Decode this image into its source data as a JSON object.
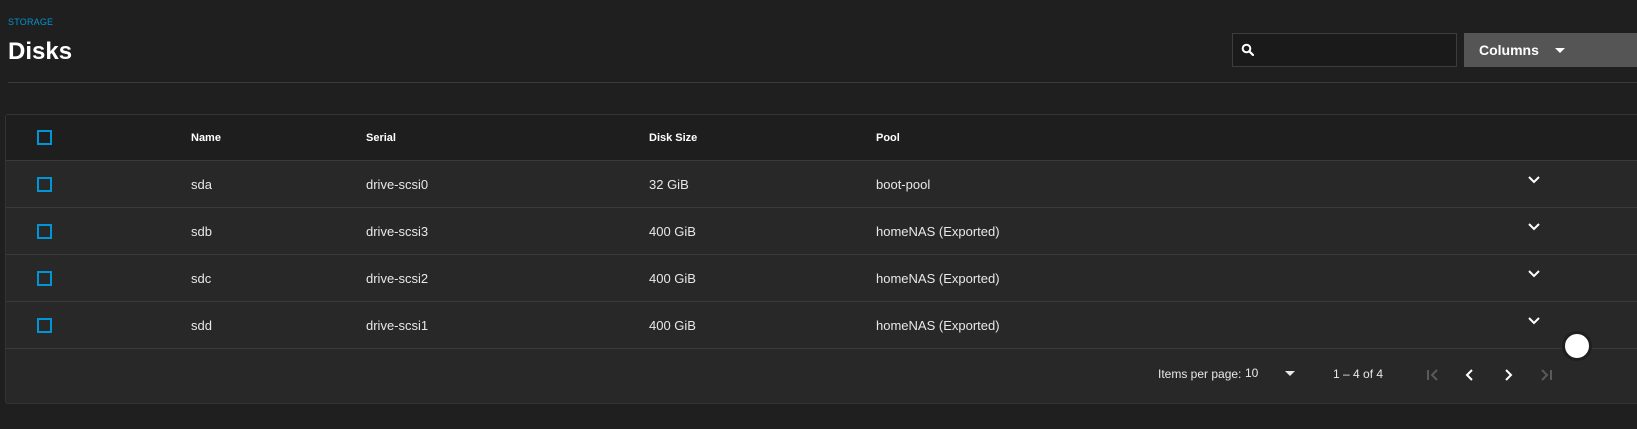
{
  "header": {
    "breadcrumb": "STORAGE",
    "title": "Disks",
    "search": {
      "value": "",
      "placeholder": "",
      "icon": "search-icon"
    },
    "columns_button": {
      "label": "Columns",
      "icon": "caret-down-icon"
    }
  },
  "table": {
    "columns": [
      "Name",
      "Serial",
      "Disk Size",
      "Pool"
    ],
    "rows": [
      {
        "name": "sda",
        "serial": "drive-scsi0",
        "size": "32 GiB",
        "pool": "boot-pool"
      },
      {
        "name": "sdb",
        "serial": "drive-scsi3",
        "size": "400 GiB",
        "pool": "homeNAS (Exported)"
      },
      {
        "name": "sdc",
        "serial": "drive-scsi2",
        "size": "400 GiB",
        "pool": "homeNAS (Exported)"
      },
      {
        "name": "sdd",
        "serial": "drive-scsi1",
        "size": "400 GiB",
        "pool": "homeNAS (Exported)"
      }
    ]
  },
  "paginator": {
    "items_per_page_label": "Items per page:",
    "items_per_page": "10",
    "range_label": "1 – 4 of 4",
    "icons": [
      "first-page-icon",
      "previous-page-icon",
      "next-page-icon",
      "last-page-icon"
    ]
  },
  "colors": {
    "accent": "#0095d5",
    "background": "#1f1f1f",
    "card": "#282828",
    "header_row": "#1e1e1e",
    "button": "#555555"
  }
}
